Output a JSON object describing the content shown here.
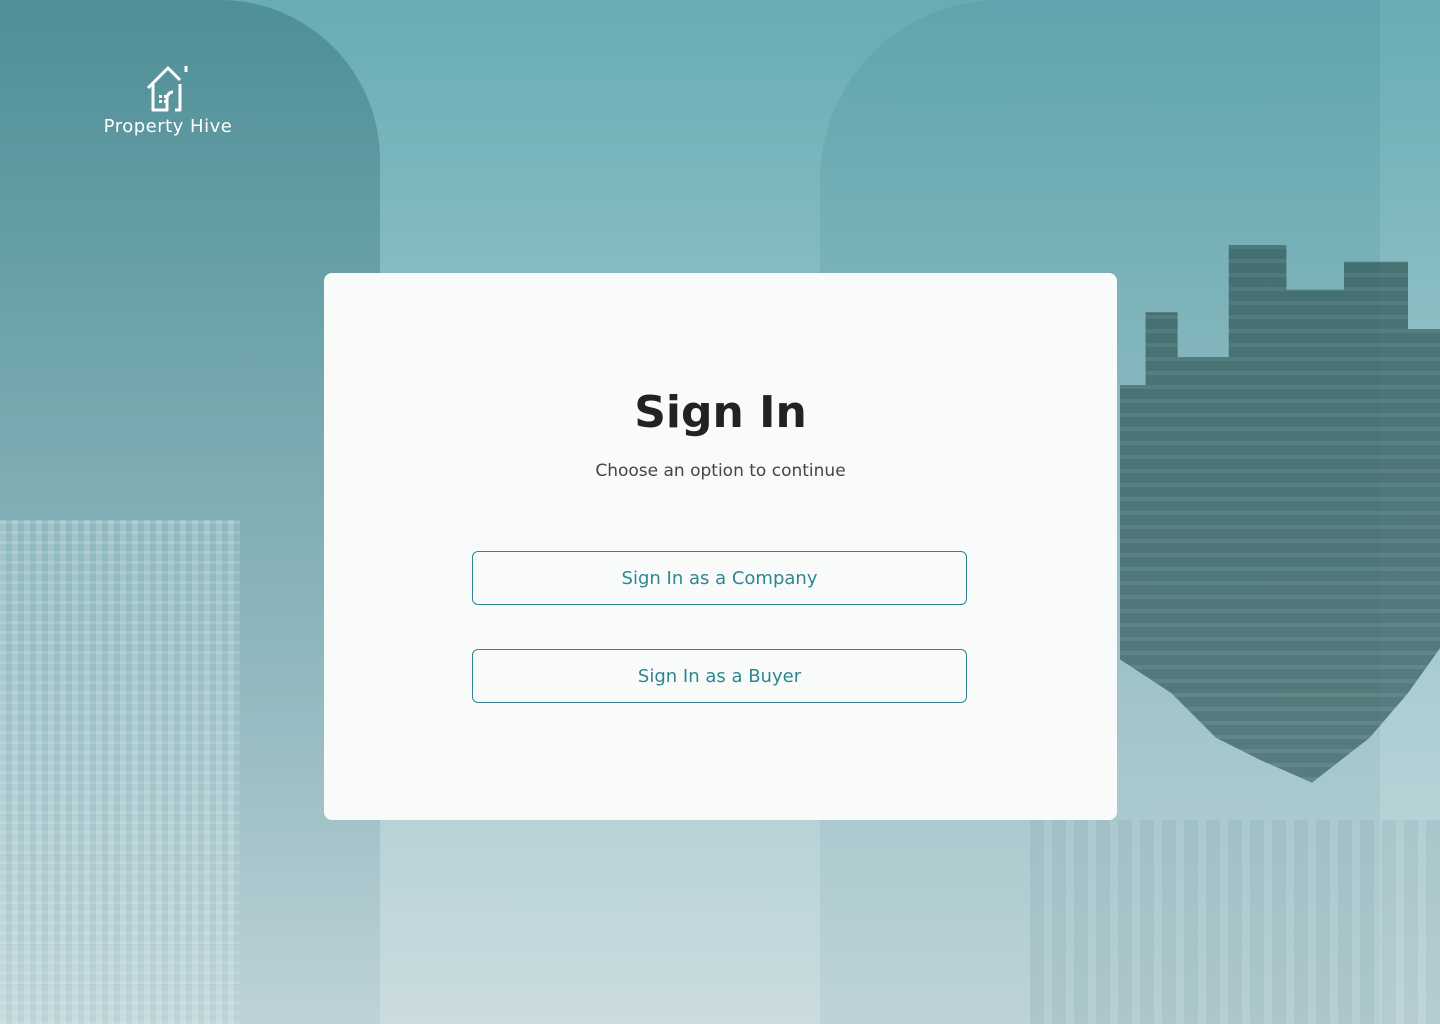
{
  "brand": {
    "name": "Property Hive",
    "icon": "house-icon"
  },
  "signin": {
    "title": "Sign In",
    "subtitle": "Choose an option to continue",
    "company_button": "Sign In as a Company",
    "buyer_button": "Sign In as a Buyer"
  },
  "colors": {
    "accent": "#2e8691",
    "card_bg": "#f9fbfb",
    "title": "#222222",
    "background_tint": "#6aaab2"
  }
}
